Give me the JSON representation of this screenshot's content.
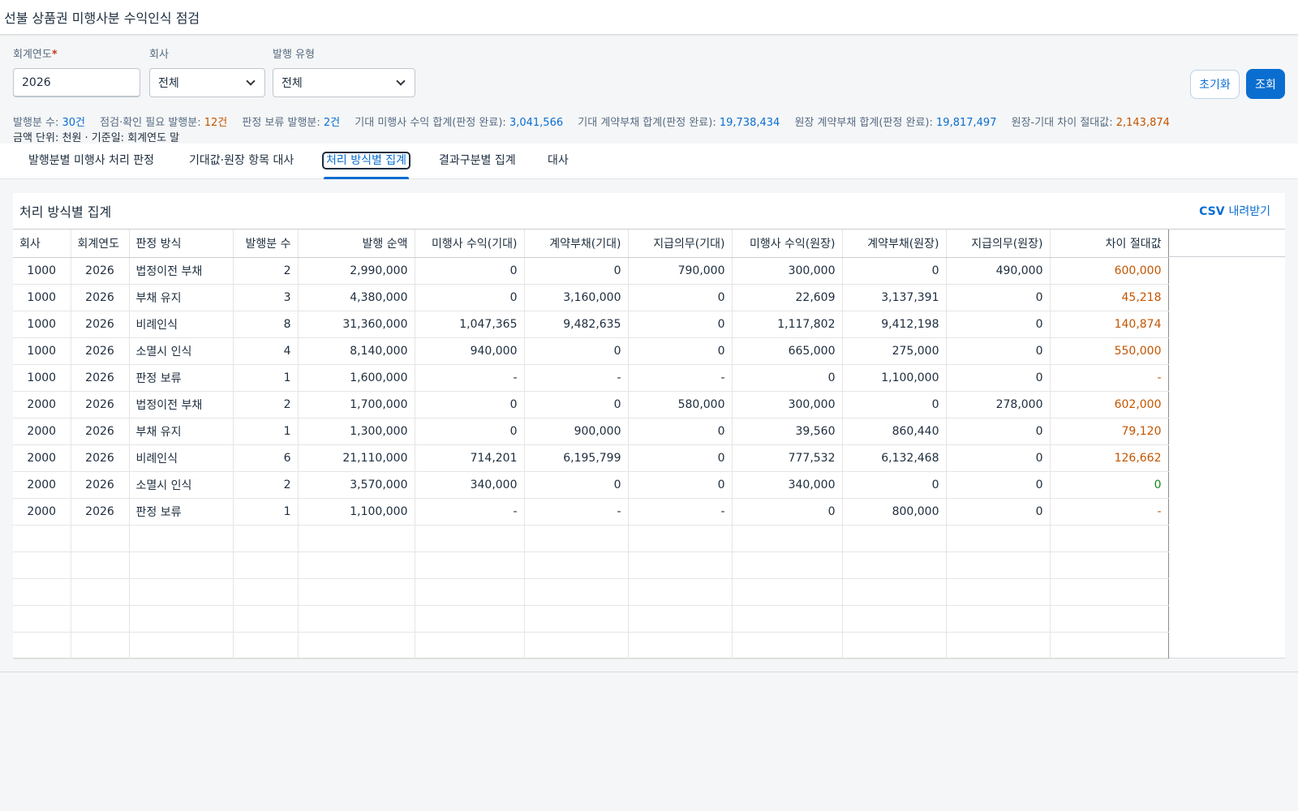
{
  "page": {
    "title": "선불 상품권 미행사분 수익인식 점검"
  },
  "filters": {
    "fiscal_year": {
      "label": "회계연도",
      "required_mark": "*",
      "value": "2026"
    },
    "company": {
      "label": "회사",
      "value": "전체"
    },
    "issue_type": {
      "label": "발행 유형",
      "value": "전체"
    }
  },
  "actions": {
    "reset_label": "초기화",
    "search_label": "조회"
  },
  "summary": {
    "issue_count_label": "발행분 수:",
    "issue_count_value": "30건",
    "check_needed_label": "점검·확인 필요 발행분:",
    "check_needed_value": "12건",
    "pending_label": "판정 보류 발행분:",
    "pending_value": "2건",
    "exp_breakage_label": "기대 미행사 수익 합계(판정 완료):",
    "exp_breakage_value": "3,041,566",
    "exp_liability_label": "기대 계약부채 합계(판정 완료):",
    "exp_liability_value": "19,738,434",
    "ledger_liability_label": "원장 계약부채 합계(판정 완료):",
    "ledger_liability_value": "19,817,497",
    "abs_diff_label": "원장-기대 차이 절대값:",
    "abs_diff_value": "2,143,874",
    "unit_line": "금액 단위: 천원 · 기준일: 회계연도 말"
  },
  "tabs": [
    {
      "label": "발행분별 미행사 처리 판정"
    },
    {
      "label": "기대값·원장 항목 대사"
    },
    {
      "label": "처리 방식별 집계"
    },
    {
      "label": "결과구분별 집계"
    },
    {
      "label": "대사"
    }
  ],
  "panel": {
    "title": "처리 방식별 집계",
    "csv_label": "CSV",
    "csv_sub": "내려받기"
  },
  "table": {
    "headers": [
      "회사",
      "회계연도",
      "판정 방식",
      "발행분 수",
      "발행 순액",
      "미행사 수익(기대)",
      "계약부채(기대)",
      "지급의무(기대)",
      "미행사 수익(원장)",
      "계약부채(원장)",
      "지급의무(원장)",
      "차이 절대값"
    ],
    "rows": [
      [
        "1000",
        "2026",
        "법정이전 부채",
        "2",
        "2,990,000",
        "0",
        "0",
        "790,000",
        "300,000",
        "0",
        "490,000",
        "600,000"
      ],
      [
        "1000",
        "2026",
        "부채 유지",
        "3",
        "4,380,000",
        "0",
        "3,160,000",
        "0",
        "22,609",
        "3,137,391",
        "0",
        "45,218"
      ],
      [
        "1000",
        "2026",
        "비례인식",
        "8",
        "31,360,000",
        "1,047,365",
        "9,482,635",
        "0",
        "1,117,802",
        "9,412,198",
        "0",
        "140,874"
      ],
      [
        "1000",
        "2026",
        "소멸시 인식",
        "4",
        "8,140,000",
        "940,000",
        "0",
        "0",
        "665,000",
        "275,000",
        "0",
        "550,000"
      ],
      [
        "1000",
        "2026",
        "판정 보류",
        "1",
        "1,600,000",
        "-",
        "-",
        "-",
        "0",
        "1,100,000",
        "0",
        "-"
      ],
      [
        "2000",
        "2026",
        "법정이전 부채",
        "2",
        "1,700,000",
        "0",
        "0",
        "580,000",
        "300,000",
        "0",
        "278,000",
        "602,000"
      ],
      [
        "2000",
        "2026",
        "부채 유지",
        "1",
        "1,300,000",
        "0",
        "900,000",
        "0",
        "39,560",
        "860,440",
        "0",
        "79,120"
      ],
      [
        "2000",
        "2026",
        "비례인식",
        "6",
        "21,110,000",
        "714,201",
        "6,195,799",
        "0",
        "777,532",
        "6,132,468",
        "0",
        "126,662"
      ],
      [
        "2000",
        "2026",
        "소멸시 인식",
        "2",
        "3,570,000",
        "340,000",
        "0",
        "0",
        "340,000",
        "0",
        "0",
        "0"
      ],
      [
        "2000",
        "2026",
        "판정 보류",
        "1",
        "1,100,000",
        "-",
        "-",
        "-",
        "0",
        "800,000",
        "0",
        "-"
      ]
    ],
    "diff_status": [
      "orange",
      "orange",
      "orange",
      "orange",
      "dash",
      "orange",
      "orange",
      "orange",
      "green",
      "dash"
    ]
  },
  "colors": {
    "accent": "#0a6ed1",
    "warning": "#c35500",
    "positive": "#188918"
  }
}
